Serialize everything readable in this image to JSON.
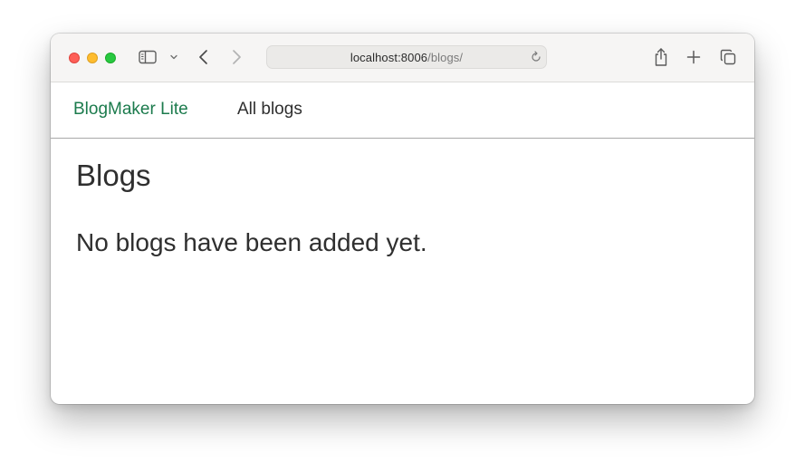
{
  "browser": {
    "address_host": "localhost:8006",
    "address_path": "/blogs/",
    "icons": {
      "sidebar": "sidebar-icon",
      "chevron": "chevron-down-icon",
      "back": "back-arrow-icon",
      "forward": "forward-arrow-icon",
      "reload": "reload-icon",
      "share": "share-icon",
      "new_tab": "plus-icon",
      "tabs": "tab-overview-icon"
    }
  },
  "navbar": {
    "brand": "BlogMaker Lite",
    "links": [
      "All blogs"
    ]
  },
  "main": {
    "title": "Blogs",
    "empty_message": "No blogs have been added yet."
  },
  "colors": {
    "brand": "#1c7b4d",
    "text": "#2f2f2f"
  }
}
